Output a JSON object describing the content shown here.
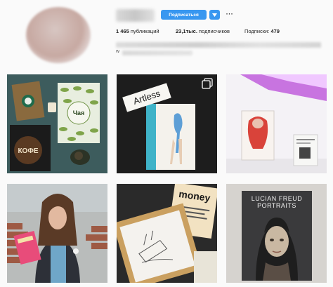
{
  "profile": {
    "follow_label": "Подписаться",
    "dropdown_icon": "caret-down-icon",
    "more_icon": "more-dots-icon",
    "more_glyph": "···",
    "stats": {
      "posts_count": "1 465",
      "posts_label": "публикаций",
      "followers_count": "23,1тыс.",
      "followers_label": "подписчиков",
      "following_label": "Подписки:",
      "following_count": "479"
    },
    "bio_fragment": "w"
  },
  "posts": [
    {
      "printed_text": [
        "Чая",
        "КОФЕ"
      ]
    },
    {
      "printed_text": [
        "Artless"
      ]
    },
    {
      "printed_text": []
    },
    {
      "printed_text": []
    },
    {
      "printed_text": [
        "money"
      ]
    },
    {
      "printed_text": [
        "LUCIAN FREUD",
        "PORTRAITS"
      ]
    }
  ],
  "colors": {
    "accent": "#3897f0",
    "text": "#262626",
    "background": "#fafafa"
  }
}
